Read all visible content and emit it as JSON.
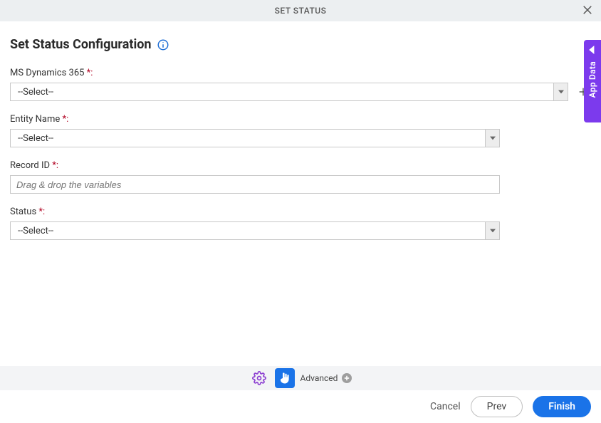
{
  "header": {
    "title": "SET STATUS"
  },
  "page": {
    "title": "Set Status Configuration"
  },
  "fields": {
    "dynamics": {
      "label": "MS Dynamics 365",
      "required_suffix": " *:",
      "value": "--Select--"
    },
    "entity": {
      "label": "Entity Name",
      "required_suffix": " *:",
      "value": "--Select--"
    },
    "record": {
      "label": "Record ID",
      "required_suffix": " *:",
      "placeholder": "Drag & drop the variables"
    },
    "status": {
      "label": "Status",
      "required_suffix": " *:",
      "value": "--Select--"
    }
  },
  "sidetab": {
    "label": "App Data"
  },
  "toolbar": {
    "advanced_label": "Advanced"
  },
  "footer": {
    "cancel": "Cancel",
    "prev": "Prev",
    "finish": "Finish"
  }
}
